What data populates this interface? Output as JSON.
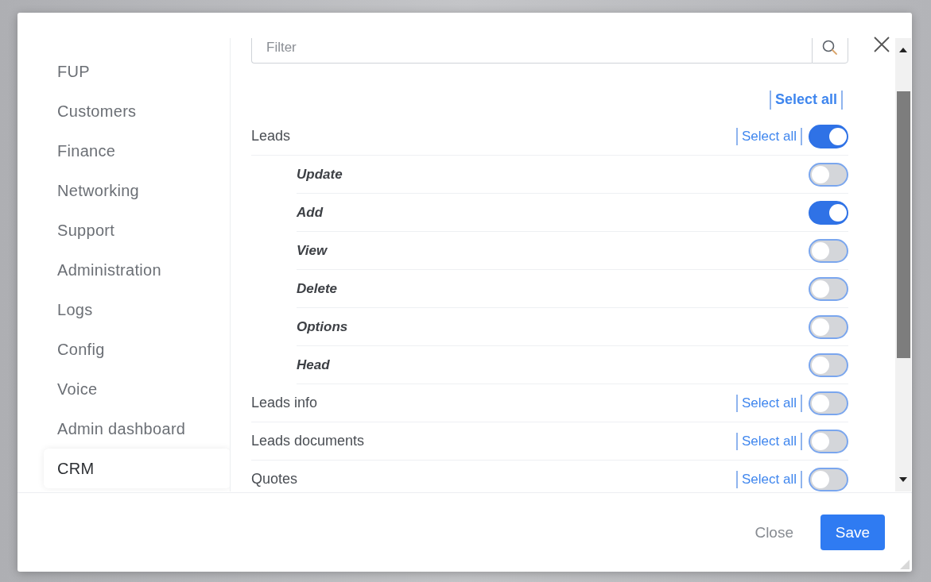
{
  "filter": {
    "placeholder": "Filter"
  },
  "select_all": "Select all",
  "sidebar": {
    "items": [
      {
        "label": "FUP",
        "selected": false
      },
      {
        "label": "Customers",
        "selected": false
      },
      {
        "label": "Finance",
        "selected": false
      },
      {
        "label": "Networking",
        "selected": false
      },
      {
        "label": "Support",
        "selected": false
      },
      {
        "label": "Administration",
        "selected": false
      },
      {
        "label": "Logs",
        "selected": false
      },
      {
        "label": "Config",
        "selected": false
      },
      {
        "label": "Voice",
        "selected": false
      },
      {
        "label": "Admin dashboard",
        "selected": false
      },
      {
        "label": "CRM",
        "selected": true
      }
    ]
  },
  "permissions": [
    {
      "label": "Leads",
      "select_all": "Select all",
      "on": true,
      "children": [
        {
          "label": "Update",
          "on": false
        },
        {
          "label": "Add",
          "on": true
        },
        {
          "label": "View",
          "on": false
        },
        {
          "label": "Delete",
          "on": false
        },
        {
          "label": "Options",
          "on": false
        },
        {
          "label": "Head",
          "on": false
        }
      ]
    },
    {
      "label": "Leads info",
      "select_all": "Select all",
      "on": false
    },
    {
      "label": "Leads documents",
      "select_all": "Select all",
      "on": false
    },
    {
      "label": "Quotes",
      "select_all": "Select all",
      "on": false
    }
  ],
  "footer": {
    "buttons": [
      {
        "label": "Close",
        "kind": "secondary"
      },
      {
        "label": "Save",
        "kind": "primary"
      }
    ]
  }
}
